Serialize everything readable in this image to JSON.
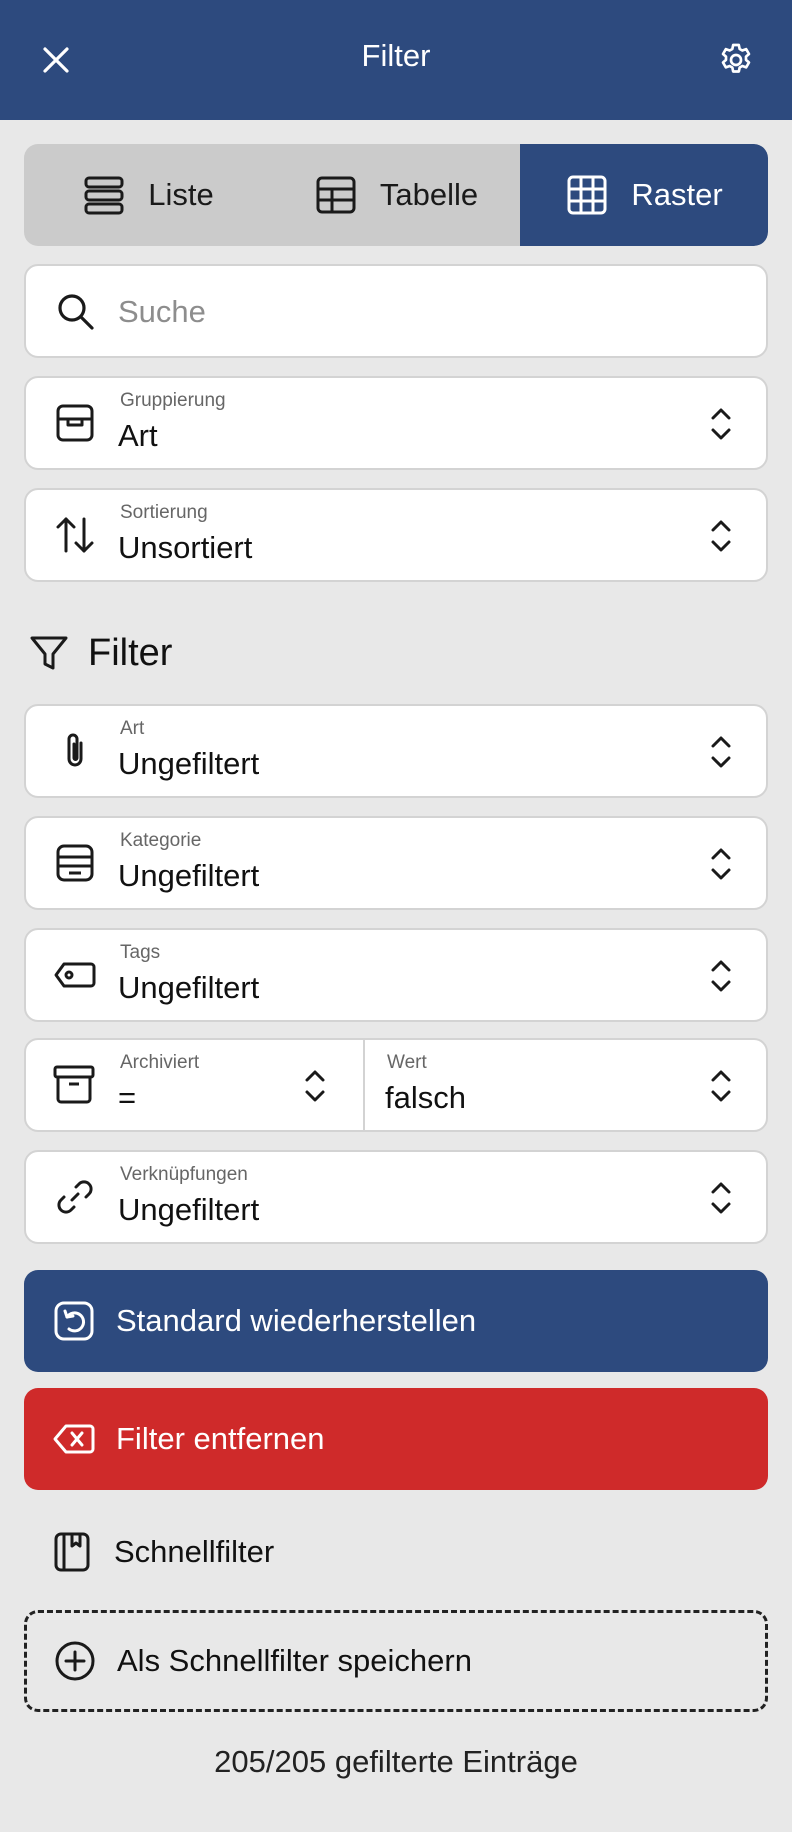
{
  "header": {
    "title": "Filter"
  },
  "view_modes": {
    "items": [
      {
        "label": "Liste"
      },
      {
        "label": "Tabelle"
      },
      {
        "label": "Raster"
      }
    ]
  },
  "search": {
    "placeholder": "Suche"
  },
  "grouping": {
    "label": "Gruppierung",
    "value": "Art"
  },
  "sorting": {
    "label": "Sortierung",
    "value": "Unsortiert"
  },
  "filter_section": {
    "title": "Filter"
  },
  "filters": {
    "art": {
      "label": "Art",
      "value": "Ungefiltert"
    },
    "kategorie": {
      "label": "Kategorie",
      "value": "Ungefiltert"
    },
    "tags": {
      "label": "Tags",
      "value": "Ungefiltert"
    },
    "archiviert": {
      "label": "Archiviert",
      "value": "="
    },
    "wert": {
      "label": "Wert",
      "value": "falsch"
    },
    "verknuepfungen": {
      "label": "Verknüpfungen",
      "value": "Ungefiltert"
    }
  },
  "buttons": {
    "restore": "Standard wiederherstellen",
    "remove": "Filter entfernen"
  },
  "quickfilter": {
    "title": "Schnellfilter",
    "save_label": "Als Schnellfilter speichern"
  },
  "status": {
    "count_text": "205/205 gefilterte Einträge"
  },
  "colors": {
    "header_bg": "#2d4a7e",
    "danger": "#cf2a2a",
    "page_bg": "#e8e8e8",
    "segment_bg": "#cbcbcb"
  }
}
